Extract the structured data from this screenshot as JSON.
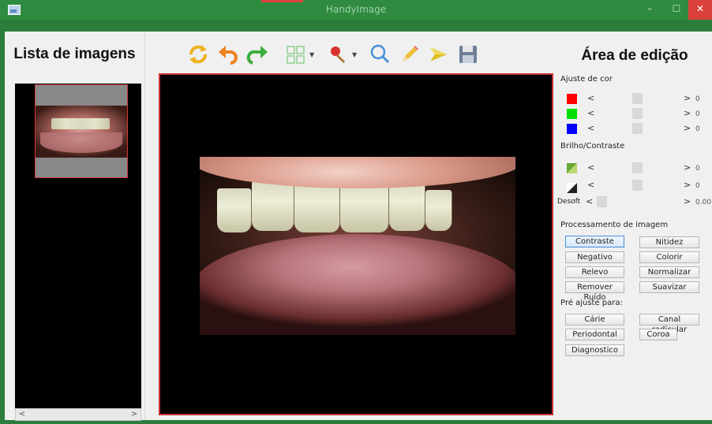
{
  "window": {
    "title": "HandyImage",
    "minimize_glyph": "–",
    "maximize_glyph": "☐",
    "close_glyph": "✕",
    "accent_color": "#2e8b3f",
    "close_color": "#d9413a"
  },
  "left_panel": {
    "title": "Lista de imagens",
    "scroll_left": "<",
    "scroll_right": ">"
  },
  "toolbar": {
    "icons": [
      "refresh-icon",
      "undo-icon",
      "redo-icon",
      "grid-icon",
      "pin-icon",
      "zoom-icon",
      "pencil-icon",
      "arrow-icon",
      "save-icon"
    ]
  },
  "right_panel": {
    "title": "Área de edição",
    "color_section": "Ajuste de cor",
    "color_sliders": [
      {
        "name": "red",
        "color": "#ff0000",
        "left": "<",
        "right": ">",
        "value": "0"
      },
      {
        "name": "green",
        "color": "#00e000",
        "left": "<",
        "right": ">",
        "value": "0"
      },
      {
        "name": "blue",
        "color": "#0000ff",
        "left": "<",
        "right": ">",
        "value": "0"
      }
    ],
    "brightness_section": "Brilho/Contraste",
    "brightness_sliders": [
      {
        "name": "brightness",
        "left": "<",
        "right": ">",
        "value": "0"
      },
      {
        "name": "contrast",
        "left": "<",
        "right": ">",
        "value": "0"
      }
    ],
    "desoft": {
      "label": "Desoft",
      "left": "<",
      "right": ">",
      "value": "0.00"
    },
    "processing_section": "Processamento de imagem",
    "processing_buttons": [
      "Contraste",
      "Nitidez",
      "Negativo",
      "Colorir",
      "Relevo",
      "Normalizar",
      "Remover Ruído",
      "Suavizar"
    ],
    "preset_section": "Pré ajuste para:",
    "preset_buttons": [
      "Cárie",
      "Canal radicular",
      "Periodontal",
      "Coroa",
      "Diagnostico"
    ]
  }
}
